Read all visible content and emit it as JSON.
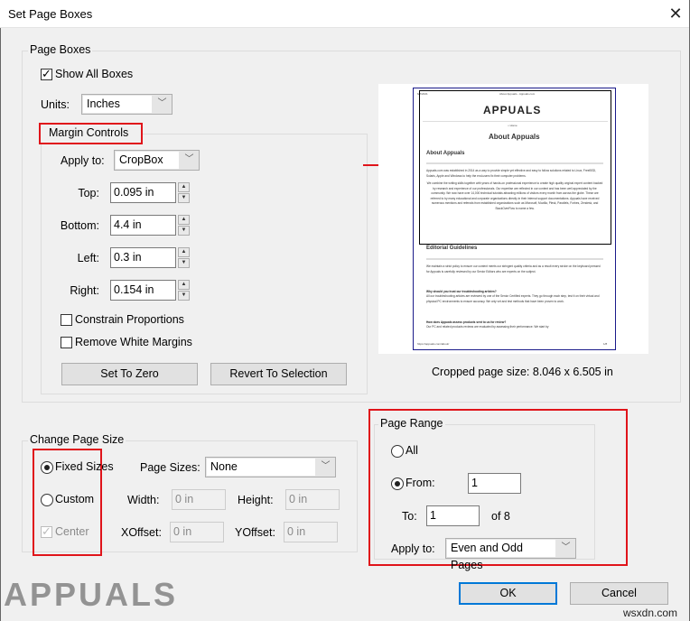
{
  "window": {
    "title": "Set Page Boxes",
    "close_icon": "close-icon"
  },
  "page_boxes": {
    "legend": "Page Boxes",
    "show_all_boxes": {
      "label": "Show All Boxes",
      "checked": true
    },
    "units": {
      "label": "Units:",
      "value": "Inches"
    }
  },
  "margin_controls": {
    "legend": "Margin Controls",
    "apply_to": {
      "label": "Apply to:",
      "value": "CropBox"
    },
    "top": {
      "label": "Top:",
      "value": "0.095 in"
    },
    "bottom": {
      "label": "Bottom:",
      "value": "4.4 in"
    },
    "left": {
      "label": "Left:",
      "value": "0.3 in"
    },
    "right": {
      "label": "Right:",
      "value": "0.154 in"
    },
    "constrain_proportions": {
      "label": "Constrain Proportions",
      "checked": false
    },
    "remove_white_margins": {
      "label": "Remove White Margins",
      "checked": false
    },
    "set_to_zero": "Set To Zero",
    "revert_to_selection": "Revert To Selection"
  },
  "preview": {
    "header_date": "6/7/2021",
    "header_title": "About Appuals - Appuals.com",
    "logo": "APPUALS",
    "home": "⌂ Home",
    "heading": "About Appuals",
    "section1": "About Appuals",
    "para1": "Appuals.com was established in 2014 as a way to provide simple yet effective and easy to follow solutions related to Linux, FreeBSD, Solaris, Apple and Windows to help the end-users fix their computer problems.",
    "para2": "We combine the writing skills together with years of hands-on professional experience to create high quality original expert content backed by research and experience of our professionals. Our expertise are reflected in our content and has been well appreciated by the community. We now have over 14,000 technical tutorials attracting millions of visitors every month from across the globe. These are referred to by many educational and corporate organizations directly in their internal support documentations. Appuals have received numerous mentions and referrals from established organizations such as Microsoft, Mozilla, Plesk, Parallels, Forbes, Zendesk, and StackOverFlow to name a few.",
    "section2": "Editorial Guidelines",
    "para3": "We maintain a strict policy to ensure our content meets our stringent quality criteria and as a result every stroke on the keyboard pressed for Appuals is carefully reviewed by our Senior Editors who are experts on the subject.",
    "q1": "Why should you trust our troubleshooting articles?",
    "para4": "All our troubleshooting articles are reviewed by one of the Senior Certified experts. They go through each step, test it on their virtual and physical PC environments to ensure accuracy. We only vet and test methods that have been proven to work.",
    "q2": "How does Appuals assess products sent to us for review?",
    "para5": "Our PC and related products reviews are evaluated by assessing their performance. We start by",
    "footer_url": "https://appuals.com/about/",
    "footer_page": "1/8",
    "cropped_size": "Cropped page size: 8.046 x 6.505 in"
  },
  "change_page_size": {
    "legend": "Change Page Size",
    "fixed_sizes": {
      "label": "Fixed Sizes",
      "selected": true
    },
    "custom": {
      "label": "Custom",
      "selected": false
    },
    "center": {
      "label": "Center",
      "checked": true,
      "disabled": true
    },
    "page_sizes": {
      "label": "Page Sizes:",
      "value": "None"
    },
    "width": {
      "label": "Width:",
      "value": "0 in"
    },
    "height": {
      "label": "Height:",
      "value": "0 in"
    },
    "xoffset": {
      "label": "XOffset:",
      "value": "0 in"
    },
    "yoffset": {
      "label": "YOffset:",
      "value": "0 in"
    }
  },
  "page_range": {
    "legend": "Page Range",
    "all": {
      "label": "All",
      "selected": false
    },
    "from": {
      "label": "From:",
      "value": "1",
      "selected": true
    },
    "to": {
      "label": "To:",
      "value": "1"
    },
    "of_total": "of 8",
    "apply_to": {
      "label": "Apply to:",
      "value": "Even and Odd Pages"
    }
  },
  "buttons": {
    "ok": "OK",
    "cancel": "Cancel"
  },
  "watermark": {
    "logo": "APPUALS",
    "site": "wsxdn.com"
  },
  "colors": {
    "highlight_red": "#e0141a",
    "default_button_blue": "#0078d7"
  }
}
